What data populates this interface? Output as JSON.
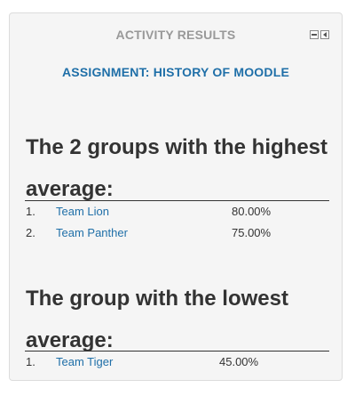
{
  "block": {
    "title": "ACTIVITY RESULTS",
    "controls": {
      "hide_icon": "collapse-icon",
      "dock_icon": "dock-icon"
    }
  },
  "assignment": {
    "label": "ASSIGNMENT: HISTORY OF MOODLE"
  },
  "highest": {
    "heading": "The 2 groups with the highest average:",
    "rows": [
      {
        "rank": "1.",
        "name": "Team Lion",
        "score": "80.00%"
      },
      {
        "rank": "2.",
        "name": "Team Panther",
        "score": "75.00%"
      }
    ]
  },
  "lowest": {
    "heading": "The group with the lowest average:",
    "rows": [
      {
        "rank": "1.",
        "name": "Team Tiger",
        "score": "45.00%"
      }
    ]
  },
  "colors": {
    "link": "#1f6fa8",
    "title": "#999999",
    "panel": "#f5f5f5",
    "text": "#333333"
  }
}
